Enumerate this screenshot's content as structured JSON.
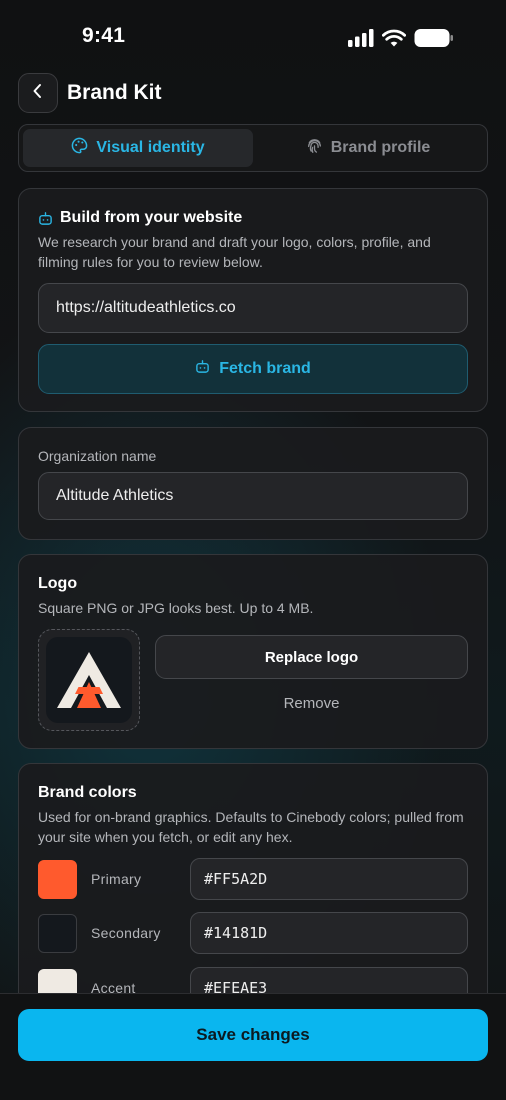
{
  "status": {
    "time": "9:41"
  },
  "header": {
    "title": "Brand Kit"
  },
  "tabs": [
    {
      "label": "Visual identity",
      "active": true,
      "icon": "palette-icon"
    },
    {
      "label": "Brand profile",
      "active": false,
      "icon": "fingerprint-icon"
    }
  ],
  "website": {
    "title": "Build from your website",
    "description": "We research your brand and draft your logo, colors, profile, and filming rules for you to review below.",
    "url_value": "https://altitudeathletics.co",
    "fetch_label": "Fetch brand"
  },
  "organization": {
    "label": "Organization name",
    "value": "Altitude Athletics"
  },
  "logo": {
    "title": "Logo",
    "description": "Square PNG or JPG looks best. Up to 4 MB.",
    "replace_label": "Replace logo",
    "remove_label": "Remove"
  },
  "brand_colors": {
    "title": "Brand colors",
    "description": "Used for on-brand graphics. Defaults to Cinebody colors; pulled from your site when you fetch, or edit any hex.",
    "items": [
      {
        "label": "Primary",
        "hex": "#FF5A2D"
      },
      {
        "label": "Secondary",
        "hex": "#14181D"
      },
      {
        "label": "Accent",
        "hex": "#EFEAE3"
      }
    ]
  },
  "footer": {
    "save_label": "Save changes"
  },
  "colors": {
    "accent": "#2AB6E4",
    "save_button": "#0AB6EF"
  }
}
